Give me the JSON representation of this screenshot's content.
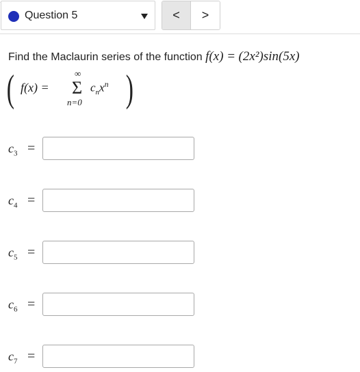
{
  "header": {
    "question_label": "Question 5",
    "prev_label": "<",
    "next_label": ">"
  },
  "problem": {
    "prompt_text": "Find the Maclaurin series of the function",
    "function_lhs": "f(x) =",
    "function_rhs": "(2x²)sin(5x)",
    "series_lhs": "f(x) =",
    "series_upper": "∞",
    "series_lower": "n=0",
    "series_sigma": "Σ",
    "series_term": "c",
    "series_term_sub": "n",
    "series_term_var": "x",
    "series_term_exp": "n"
  },
  "coefficients": [
    {
      "label": "c",
      "sub": "3",
      "eq": "=",
      "value": ""
    },
    {
      "label": "c",
      "sub": "4",
      "eq": "=",
      "value": ""
    },
    {
      "label": "c",
      "sub": "5",
      "eq": "=",
      "value": ""
    },
    {
      "label": "c",
      "sub": "6",
      "eq": "=",
      "value": ""
    },
    {
      "label": "c",
      "sub": "7",
      "eq": "=",
      "value": ""
    }
  ],
  "colors": {
    "question_dot": "#1f2fb8"
  }
}
